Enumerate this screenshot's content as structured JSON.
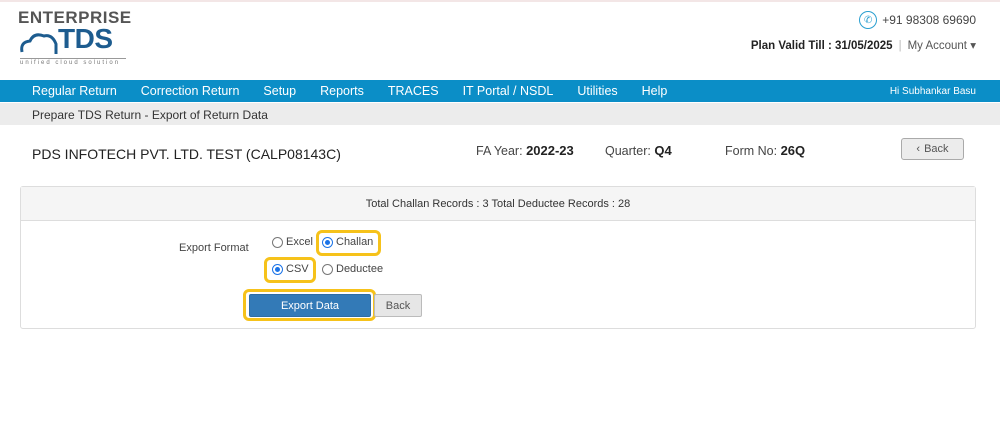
{
  "logo": {
    "line1": "ENTERPRISE",
    "line2": "TDS",
    "tagline": "unified cloud solution"
  },
  "header": {
    "phone": "+91 98308 69690",
    "plan_label": "Plan Valid Till : 31/05/2025",
    "separator": "|",
    "account": "My Account"
  },
  "nav": {
    "items": [
      "Regular Return",
      "Correction Return",
      "Setup",
      "Reports",
      "TRACES",
      "IT Portal / NSDL",
      "Utilities",
      "Help"
    ],
    "user": "Hi Subhankar Basu"
  },
  "breadcrumb": "Prepare TDS Return - Export of Return Data",
  "info": {
    "company": "PDS INFOTECH PVT. LTD. TEST (CALP08143C)",
    "fa_label": "FA Year:",
    "fa_value": "2022-23",
    "quarter_label": "Quarter:",
    "quarter_value": "Q4",
    "form_label": "Form No:",
    "form_value": "26Q",
    "back": "Back"
  },
  "panel": {
    "summary": "Total Challan Records : 3 Total Deductee Records : 28",
    "export_format_label": "Export Format",
    "options": {
      "excel": "Excel",
      "challan": "Challan",
      "csv": "CSV",
      "deductee": "Deductee"
    },
    "selected": {
      "format": "CSV",
      "type": "Challan"
    },
    "export_button": "Export Data",
    "back_button": "Back"
  },
  "colors": {
    "nav": "#0b8ec7",
    "primary": "#337ab7",
    "highlight": "#f6c21a"
  }
}
